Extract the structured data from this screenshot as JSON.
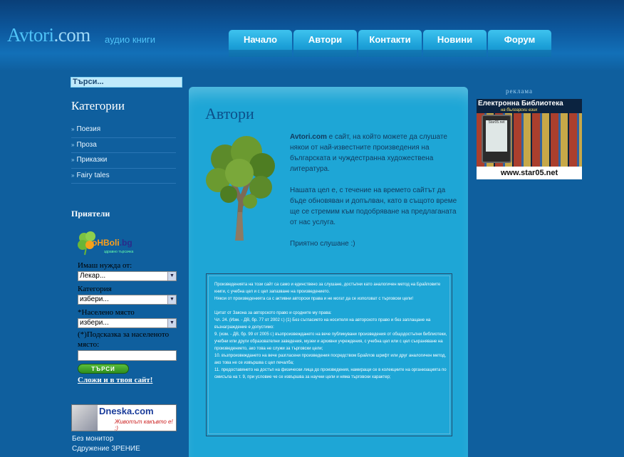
{
  "header": {
    "logo_main": "Avtori",
    "logo_domain": ".com",
    "logo_sub": "аудио книги",
    "nav": [
      "Начало",
      "Автори",
      "Контакти",
      "Новини",
      "Форум"
    ]
  },
  "sidebar": {
    "search_placeholder": "Търси...",
    "categories_title": "Категории",
    "categories": [
      "Поезия",
      "Проза",
      "Приказки",
      "Fairy tales"
    ],
    "friends_title": "Приятели",
    "ohboli": {
      "name": "oHBoli",
      "tld": ".bg",
      "tagline": "здравно търсачка",
      "need_label": "Имаш нужда от:",
      "need_value": "Лекар...",
      "category_label": "Категория",
      "category_value": "избери...",
      "place_label": "*Населено място",
      "place_value": "избери...",
      "hint_label": "(*)Подсказка за населеното място:",
      "search_button": "ТЪРСИ",
      "add_link": "Сложи и в твоя сайт!"
    },
    "dneska": {
      "title": "Dneska.com",
      "slogan": "Животът какъвто е! ;)"
    },
    "bottom_links": [
      "Без монитор",
      "Сдружение ЗРЕНИЕ"
    ]
  },
  "main": {
    "title": "Автори",
    "intro_site": "Avtori.com",
    "intro_p1": " е сайт, на който можете да слушате някои от най-известните произведения на българската и чуждестранна художествена литература.",
    "intro_p2": "Нашата цел е, с течение на времето сайтът да бъде обновяван и допълван, като в същото време ще се стремим към подобряване на предлаганата от нас услуга.",
    "intro_p3": "Приятно слушане :)",
    "legal": {
      "p1": "Произведенията на този сайт са само и единствено за слушане, достъпни като аналогичен метод на Брайловите книги, с учебна цел и с цел запазване на произведението.",
      "p2": "Някои от произведенията са с активни авторски права и не могат да се използват с търговски цели!",
      "p3": "Цитат от Закона за авторското право и сродните му права:",
      "p4": "Чл. 24. (Изм. - ДВ, бр. 77 от 2002 г.) (1) Без съгласието на носителя на авторското право и без заплащане на възнаграждение е допустимо:",
      "p5": "9. (изм. - ДВ, бр. 99 от 2005 г.) възпроизвеждането на вече публикувани произведения от общодостъпни библиотеки, учебни или други образователни заведения, музеи и архивни учреждения, с учебна цел или с цел съхраняване на произведението, ако това не служи за търговски цели;",
      "p6": "10. възпроизвеждането на вече разгласени произведения посредством Брайлов шрифт или друг аналогичен метод, ако това не се извършва с цел печалба;",
      "p7": "11. предоставянето на достъп на физически лица до произведения, намиращи се в колекциите на организацията по смисъла на т. 9, при условие че се извършва за научни цели и няма търговски характер;"
    }
  },
  "ad": {
    "label": "реклама",
    "title": "Електронна Библиотека",
    "subtitle": "на български език",
    "reader_label": "Star05.net",
    "url": "www.star05.net"
  },
  "colors": {
    "background": "#0f5f9e",
    "panel": "#1ea6d6",
    "nav": "#1ca0d8",
    "logo": "#4fc3f7"
  }
}
